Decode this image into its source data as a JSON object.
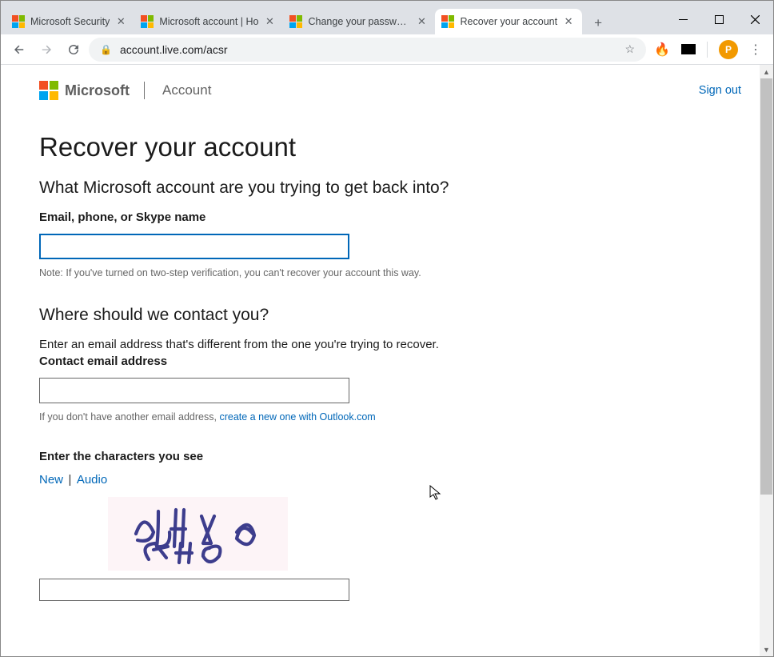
{
  "browser": {
    "tabs": [
      {
        "title": "Microsoft Security",
        "active": false
      },
      {
        "title": "Microsoft account | Ho",
        "active": false
      },
      {
        "title": "Change your password",
        "active": false
      },
      {
        "title": "Recover your account",
        "active": true
      }
    ],
    "url": "account.live.com/acsr",
    "avatar_initial": "P"
  },
  "header": {
    "brand": "Microsoft",
    "section": "Account",
    "signout": "Sign out"
  },
  "page": {
    "title": "Recover your account",
    "q1": {
      "heading": "What Microsoft account are you trying to get back into?",
      "label": "Email, phone, or Skype name",
      "value": "",
      "note": "Note: If you've turned on two-step verification, you can't recover your account this way."
    },
    "q2": {
      "heading": "Where should we contact you?",
      "desc": "Enter an email address that's different from the one you're trying to recover.",
      "label": "Contact email address",
      "value": "",
      "note_prefix": "If you don't have another email address, ",
      "note_link": "create a new one with Outlook.com"
    },
    "captcha": {
      "label": "Enter the characters you see",
      "new": "New",
      "audio": "Audio"
    }
  }
}
